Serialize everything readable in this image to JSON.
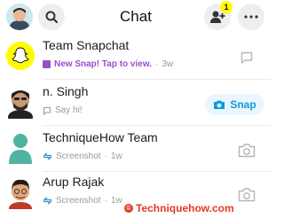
{
  "header": {
    "title": "Chat",
    "badge_count": "1"
  },
  "chats": [
    {
      "name": "Team Snapchat",
      "status": "New Snap! Tap to view.",
      "time": "3w",
      "status_color": "#9b4ccf"
    },
    {
      "name": "n. Singh",
      "status": "Say hi!",
      "action": "Snap"
    },
    {
      "name": "TechniqueHow Team",
      "status": "Screenshot",
      "time": "1w"
    },
    {
      "name": "Arup Rajak",
      "status": "Screenshot",
      "time": "1w"
    }
  ],
  "watermark": {
    "text": "Techniquehow.com"
  },
  "colors": {
    "accent": "#0f9bd7",
    "snap_yellow": "#fffc00",
    "watermark": "#e63a22"
  }
}
